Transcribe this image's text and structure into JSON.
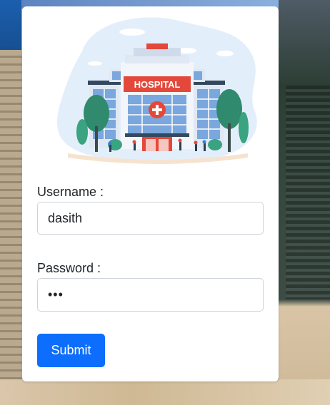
{
  "form": {
    "username_label": "Username :",
    "username_value": "dasith",
    "password_label": "Password :",
    "password_value": "•••",
    "submit_label": "Submit"
  },
  "illustration": {
    "sign_text": "HOSPITAL",
    "icon": "hospital-building-icon"
  },
  "colors": {
    "primary": "#0d6efd",
    "sign_red": "#e4483a"
  }
}
